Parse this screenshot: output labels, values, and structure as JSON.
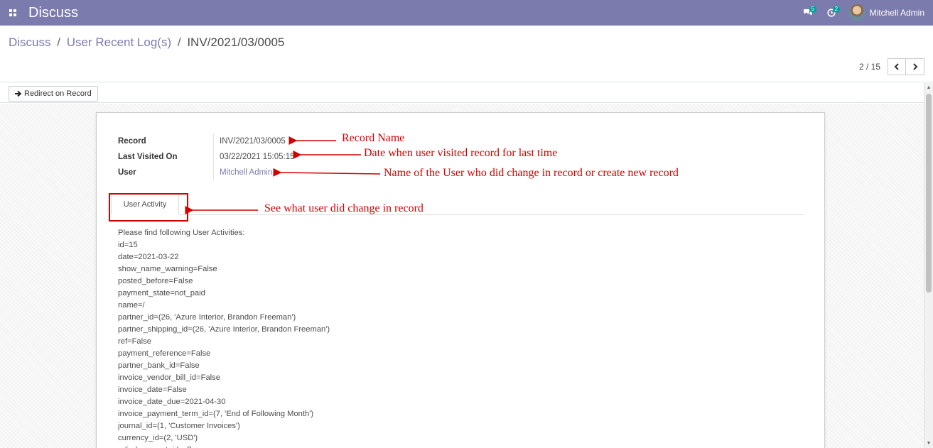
{
  "navbar": {
    "app_title": "Discuss",
    "messages_count": "5",
    "activities_count": "2",
    "user_name": "Mitchell Admin"
  },
  "breadcrumb": {
    "items": [
      "Discuss",
      "User Recent Log(s)"
    ],
    "separator": "/",
    "current": "INV/2021/03/0005"
  },
  "pager": {
    "value": "2 / 15"
  },
  "buttons": {
    "redirect_label": "Redirect on Record"
  },
  "record": {
    "record_label": "Record",
    "record_value": "INV/2021/03/0005",
    "last_visited_label": "Last Visited On",
    "last_visited_value": "03/22/2021 15:05:15",
    "user_label": "User",
    "user_value": "Mitchell Admin"
  },
  "tabs": {
    "user_activity": "User Activity"
  },
  "activity_lines": [
    "Please find following User Activities:",
    "id=15",
    "date=2021-03-22",
    "show_name_warning=False",
    "posted_before=False",
    "payment_state=not_paid",
    "name=/",
    "partner_id=(26, 'Azure Interior, Brandon Freeman')",
    "partner_shipping_id=(26, 'Azure Interior, Brandon Freeman')",
    "ref=False",
    "payment_reference=False",
    "partner_bank_id=False",
    "invoice_vendor_bill_id=False",
    "invoice_date=False",
    "invoice_date_due=2021-04-30",
    "invoice_payment_term_id=(7, 'End of Following Month')",
    "journal_id=(1, 'Customer Invoices')",
    "currency_id=(2, 'USD')",
    "edi_document_ids=[]"
  ],
  "annotations": {
    "record_name": "Record Name",
    "date_visited": "Date when user visited record for last time",
    "user_name": "Name of the User who did change in record or create new record",
    "user_activity": "See what user did change in record"
  },
  "colors": {
    "navbar": "#7c7bad",
    "annotation": "#d40000",
    "badge": "#00a09d"
  }
}
